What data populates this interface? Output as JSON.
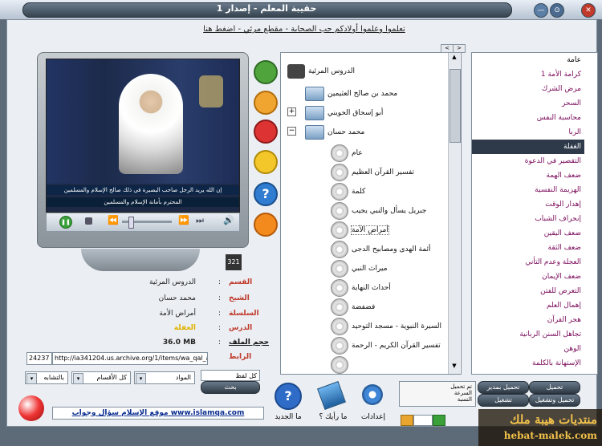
{
  "window": {
    "title": "حقيبة المعلم - إصدار 1",
    "banner_link": "تعلموا وعلموا أولادكم حب الصحابة - مقطع مرئي - اضغط هنا"
  },
  "video": {
    "ticker_top": "إن الله يريد الرجل صاحب البصيرة في ذلك صالح الإسلام والمسلمين",
    "ticker_bottom": "المحترم بأمانة الإسلام والمسلمين"
  },
  "info": {
    "section_label": "القسم",
    "section_value": "الدروس المرئية",
    "sheikh_label": "الشيخ",
    "sheikh_value": "محمد حسان",
    "series_label": "السلسلة",
    "series_value": "أمراض الأمة",
    "lesson_label": "الدرس",
    "lesson_value": "الغفلة",
    "size_label": "حجم الملف",
    "size_value": "36.0 MB",
    "link_label": "الرابط",
    "link_value": "http://ia341204.us.archive.org/1/items/wa_qal_aln",
    "link_id": "24237"
  },
  "tree": {
    "root": "الدروس المرئية",
    "sheikhs": [
      "محمد بن صالح العثيمين",
      "أبو إسحاق الحويني",
      "محمد حسان"
    ],
    "series": [
      "عام",
      "تفسير القرآن العظيم",
      "كلمة",
      "جبريل يسأل والنبي يجيب",
      "أمراض الأمة",
      "أئمة الهدى ومصابيح الدجى",
      "ميراث النبي",
      "أحداث النهاية",
      "فضفضة",
      "السيرة النبوية - مسجد التوحيد",
      "تفسير القرآن الكريم - الرحمة"
    ]
  },
  "lessons": {
    "header": "عامة",
    "items": [
      "كرامة الأمة 1",
      "مرض الشرك",
      "السحر",
      "محاسبة النفس",
      "الربا",
      "الغفلة",
      "التقصير في الدعوة",
      "ضعف الهمة",
      "الهزيمة النفسية",
      "إهدار الوقت",
      "إنحراف الشباب",
      "ضعف اليقين",
      "ضعف الثقة",
      "العجلة وعدم التأني",
      "ضعف الإيمان",
      "التعرض للفتن",
      "إهمال العلم",
      "هجر القرآن",
      "تجاهل السنن الربانية",
      "الوهن",
      "الإستهانة بالكلمة"
    ],
    "selected_index": 5
  },
  "search": {
    "field_label": "كل لفظ",
    "search_button": "بحث",
    "combo_subject": "المواد",
    "combo_section": "كل الأقسام",
    "combo_match": "بالتشابه"
  },
  "bottom": {
    "whats_new": "ما الجديد",
    "your_opinion": "ما رأيك ؟",
    "settings": "إعدادات",
    "download_load": "تم تحميل",
    "download_speed": "السرعة",
    "download_percent": "النسبة",
    "btn_download": "تحميل",
    "btn_manage_download": "تحميل بمدير",
    "btn_play": "تشغيل",
    "btn_download_play": "تحميل وتشغيل",
    "website_link": "موقع الإسلام سؤال وجواب www.islamqa.com"
  },
  "watermark": {
    "line1": "منتديات هيبة ملك",
    "line2": "hebat-malek.com"
  }
}
